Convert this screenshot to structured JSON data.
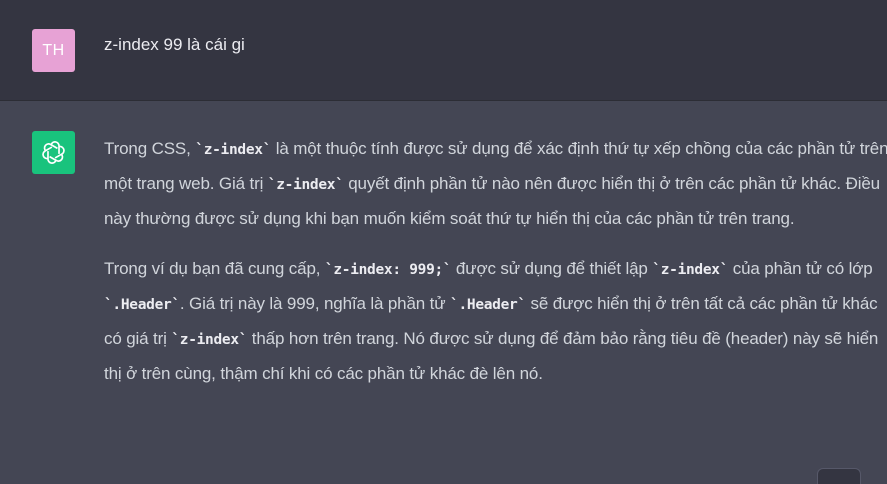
{
  "user_message": {
    "avatar_initials": "TH",
    "text": "z-index 99 là cái gi"
  },
  "assistant_message": {
    "paragraph_1": [
      {
        "type": "text",
        "text": "Trong CSS, "
      },
      {
        "type": "code",
        "text": "`z-index`"
      },
      {
        "type": "text",
        "text": " là một thuộc tính được sử dụng để xác định thứ tự xếp chồng của các phần tử trên một trang web. Giá trị "
      },
      {
        "type": "code",
        "text": "`z-index`"
      },
      {
        "type": "text",
        "text": " quyết định phần tử nào nên được hiển thị ở trên các phần tử khác. Điều này thường được sử dụng khi bạn muốn kiểm soát thứ tự hiển thị của các phần tử trên trang."
      }
    ],
    "paragraph_2": [
      {
        "type": "text",
        "text": "Trong ví dụ bạn đã cung cấp, "
      },
      {
        "type": "code",
        "text": "`z-index: 999;`"
      },
      {
        "type": "text",
        "text": " được sử dụng để thiết lập "
      },
      {
        "type": "code",
        "text": "`z-index`"
      },
      {
        "type": "text",
        "text": " của phần tử có lớp "
      },
      {
        "type": "code",
        "text": "`.Header`"
      },
      {
        "type": "text",
        "text": ". Giá trị này là 999, nghĩa là phần tử "
      },
      {
        "type": "code",
        "text": "`.Header`"
      },
      {
        "type": "text",
        "text": " sẽ được hiển thị ở trên tất cả các phần tử khác có giá trị "
      },
      {
        "type": "code",
        "text": "`z-index`"
      },
      {
        "type": "text",
        "text": " thấp hơn trên trang. Nó được sử dụng để đảm bảo rằng tiêu đề (header) này sẽ hiển thị ở trên cùng, thậm chí khi có các phần tử khác đè lên nó."
      }
    ]
  },
  "icons": {
    "assistant_logo": "openai-logo-icon"
  },
  "colors": {
    "user_row_bg": "#343541",
    "assistant_row_bg": "#444654",
    "user_avatar_bg": "#e7a2d5",
    "assistant_avatar_bg": "#19c37d",
    "text": "#d1d5db"
  }
}
